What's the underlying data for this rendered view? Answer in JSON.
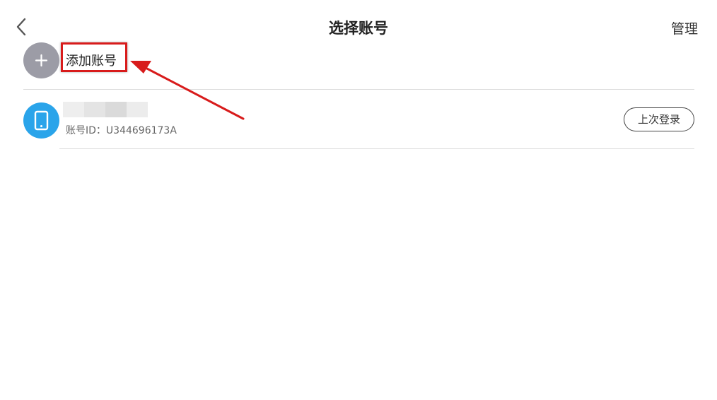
{
  "header": {
    "title": "选择账号",
    "manage_label": "管理",
    "back_icon": "chevron-left-icon"
  },
  "add_account": {
    "icon": "plus-icon",
    "label": "添加账号"
  },
  "accounts": [
    {
      "icon": "phone-icon",
      "name_masked": true,
      "id_text": "账号ID：U344696173A",
      "badge": "上次登录"
    }
  ],
  "colors": {
    "add_icon_bg": "#9c9ca6",
    "avatar_bg": "#2aa4ea",
    "highlight": "#d81b1b",
    "divider": "#dcdcdc"
  }
}
